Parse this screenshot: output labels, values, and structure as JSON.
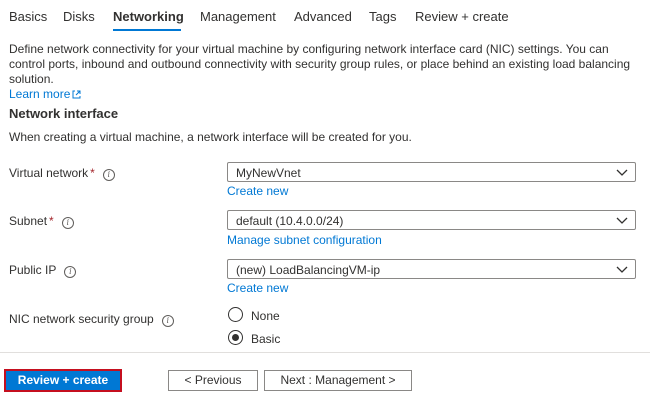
{
  "tabs": [
    {
      "label": "Basics"
    },
    {
      "label": "Disks"
    },
    {
      "label": "Networking",
      "active": true
    },
    {
      "label": "Management"
    },
    {
      "label": "Advanced"
    },
    {
      "label": "Tags"
    },
    {
      "label": "Review + create"
    }
  ],
  "description": {
    "text": "Define network connectivity for your virtual machine by configuring network interface card (NIC) settings. You can control ports, inbound and outbound connectivity with security group rules, or place behind an existing load balancing solution.",
    "learn_more": "Learn more",
    "learn_more_icon": "external-link-icon"
  },
  "network_interface": {
    "title": "Network interface",
    "note": "When creating a virtual machine, a network interface will be created for you.",
    "virtual_network": {
      "label": "Virtual network",
      "required": "*",
      "value": "MyNewVnet",
      "link": "Create new"
    },
    "subnet": {
      "label": "Subnet",
      "required": "*",
      "value": "default (10.4.0.0/24)",
      "link": "Manage subnet configuration"
    },
    "public_ip": {
      "label": "Public IP",
      "value": "(new) LoadBalancingVM-ip",
      "link": "Create new"
    },
    "nsg": {
      "label": "NIC network security group",
      "options": [
        "None",
        "Basic"
      ],
      "selected": "Basic"
    }
  },
  "footer": {
    "review_create": "Review + create",
    "previous": "< Previous",
    "next": "Next : Management >"
  },
  "colors": {
    "accent": "#0078d4",
    "highlight_border": "#c50f1f",
    "required": "#a4262c"
  }
}
